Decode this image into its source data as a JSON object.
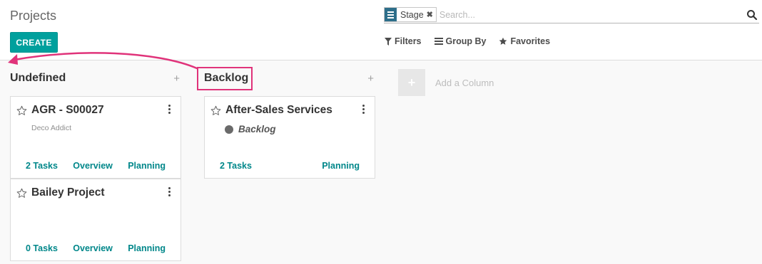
{
  "header": {
    "title": "Projects",
    "create_label": "CREATE"
  },
  "search": {
    "facet_label": "Stage",
    "facet_remove": "✖",
    "placeholder": "Search..."
  },
  "filters": {
    "filters_label": "Filters",
    "groupby_label": "Group By",
    "favorites_label": "Favorites"
  },
  "columns": [
    {
      "title": "Undefined",
      "add": "+",
      "cards": [
        {
          "title": "AGR - S00027",
          "subtitle": "Deco Addict",
          "tasks": "2 Tasks",
          "overview": "Overview",
          "planning": "Planning"
        },
        {
          "title": "Bailey Project",
          "subtitle": "",
          "tasks": "0 Tasks",
          "overview": "Overview",
          "planning": "Planning"
        }
      ]
    },
    {
      "title": "Backlog",
      "add": "+",
      "cards": [
        {
          "title": "After-Sales Services",
          "stage": "Backlog",
          "tasks": "2 Tasks",
          "planning": "Planning"
        }
      ]
    }
  ],
  "add_column": {
    "icon": "+",
    "label": "Add a Column"
  },
  "colors": {
    "primary": "#00a09d",
    "link": "#00878a",
    "annotation": "#e0337a",
    "facet": "#2d6e8a"
  }
}
